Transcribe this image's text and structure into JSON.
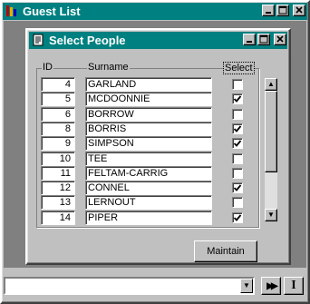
{
  "outer_window": {
    "title": "Guest List"
  },
  "inner_window": {
    "title": "Select People"
  },
  "columns": {
    "id": "ID",
    "surname": "Surname",
    "select": "Select"
  },
  "rows": [
    {
      "id": "4",
      "surname": "GARLAND",
      "checked": false
    },
    {
      "id": "5",
      "surname": "MCDOONNIE",
      "checked": true
    },
    {
      "id": "6",
      "surname": "BORROW",
      "checked": false
    },
    {
      "id": "8",
      "surname": "BORRIS",
      "checked": true
    },
    {
      "id": "9",
      "surname": "SIMPSON",
      "checked": true
    },
    {
      "id": "10",
      "surname": "TEE",
      "checked": false
    },
    {
      "id": "11",
      "surname": "FELTAM-CARRIG",
      "checked": false
    },
    {
      "id": "12",
      "surname": "CONNEL",
      "checked": true
    },
    {
      "id": "13",
      "surname": "LERNOUT",
      "checked": false
    },
    {
      "id": "14",
      "surname": "PIPER",
      "checked": true
    }
  ],
  "buttons": {
    "maintain": "Maintain"
  },
  "toolbar": {
    "combo_value": "",
    "next_glyph": "▶▶",
    "cursor_glyph": "I"
  },
  "colors": {
    "titlebar": "#008080",
    "face": "#c0c0c0",
    "mdi": "#808080"
  }
}
